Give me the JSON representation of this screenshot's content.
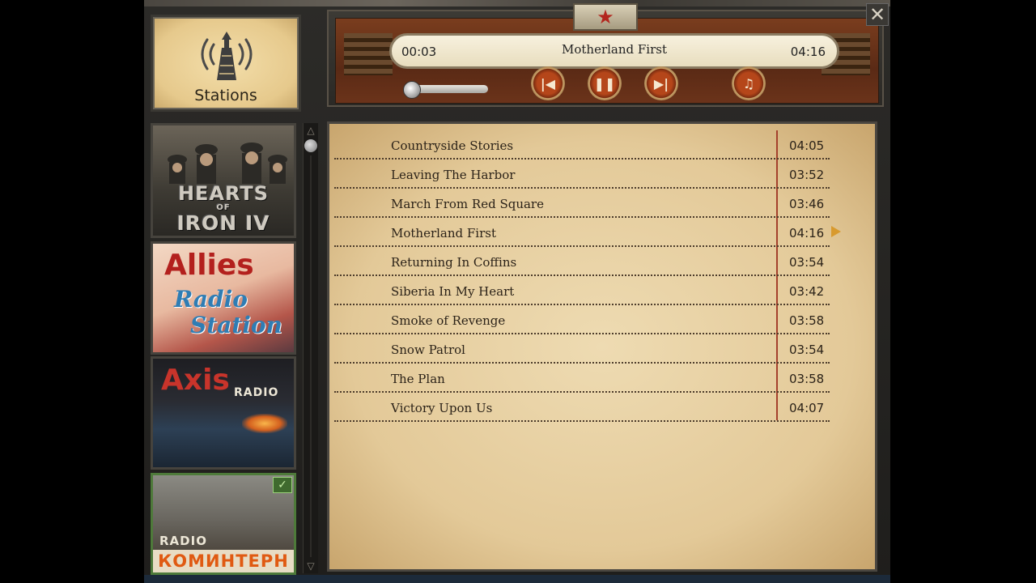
{
  "stations_button": {
    "label": "Stations",
    "icon": "radio-tower-icon"
  },
  "player": {
    "current_time": "00:03",
    "total_time": "04:16",
    "track_title": "Motherland First",
    "volume": 0.05,
    "controls": [
      {
        "name": "previous-button",
        "icon": "previous-track-icon",
        "glyph": "|◀"
      },
      {
        "name": "pause-button",
        "icon": "pause-icon",
        "glyph": "❚❚"
      },
      {
        "name": "next-button",
        "icon": "next-track-icon",
        "glyph": "▶|"
      },
      {
        "name": "music-note-button",
        "icon": "music-note-icon",
        "glyph": "♫"
      }
    ]
  },
  "stations": [
    {
      "name": "hearts-of-iron-iv",
      "l1": "HEARTS",
      "l2": "OF",
      "l3": "IRON IV"
    },
    {
      "name": "allies-radio-station",
      "title": "Allies",
      "radio": "Radio",
      "station": "Station"
    },
    {
      "name": "axis-radio",
      "title": "Axis",
      "radio": "RADIO"
    },
    {
      "name": "radio-komintern",
      "radio": "RADIO",
      "title": "КОМИНТЕРН",
      "selected": true
    }
  ],
  "playlist": [
    {
      "title": "Countryside Stories",
      "duration": "04:05"
    },
    {
      "title": "Leaving The Harbor",
      "duration": "03:52"
    },
    {
      "title": "March From Red Square",
      "duration": "03:46"
    },
    {
      "title": "Motherland First",
      "duration": "04:16"
    },
    {
      "title": "Returning In Coffins",
      "duration": "03:54"
    },
    {
      "title": "Siberia In My Heart",
      "duration": "03:42"
    },
    {
      "title": "Smoke of Revenge",
      "duration": "03:58"
    },
    {
      "title": "Snow Patrol",
      "duration": "03:54"
    },
    {
      "title": "The Plan",
      "duration": "03:58"
    },
    {
      "title": "Victory Upon Us",
      "duration": "04:07"
    }
  ],
  "colors": {
    "accent_red": "#b3261e",
    "paper": "#e8d2a6",
    "now_playing": "#d89a2e"
  }
}
